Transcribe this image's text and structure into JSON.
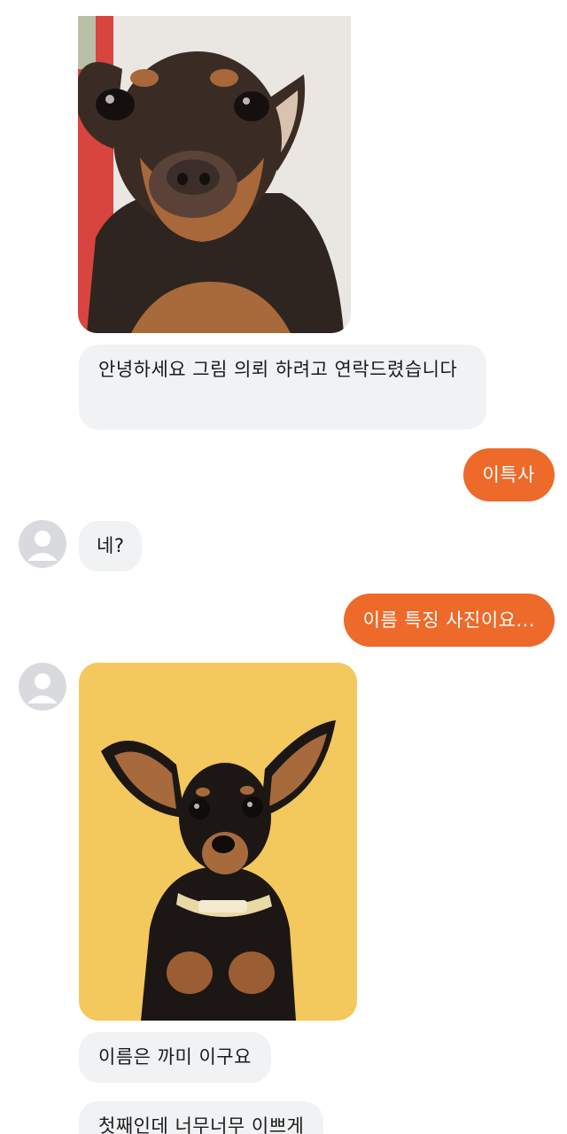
{
  "messages": {
    "m1_photo": "dog-photo-closeup",
    "m2_text": "안녕하세요 그림 의뢰 하려고 연락드렸습니다",
    "m3_text": "이특사",
    "m4_text": "네?",
    "m5_text": "이름 특징 사진이요...",
    "m6_photo": "dog-photo-yellow-background",
    "m7_text": "이름은 까미 이구요",
    "m8_text": "첫째인데 너무너무 이쁘게"
  },
  "colors": {
    "outgoing_bubble": "#ed6a2a",
    "incoming_bubble": "#f1f2f4",
    "yellow_background": "#f3c85c"
  }
}
